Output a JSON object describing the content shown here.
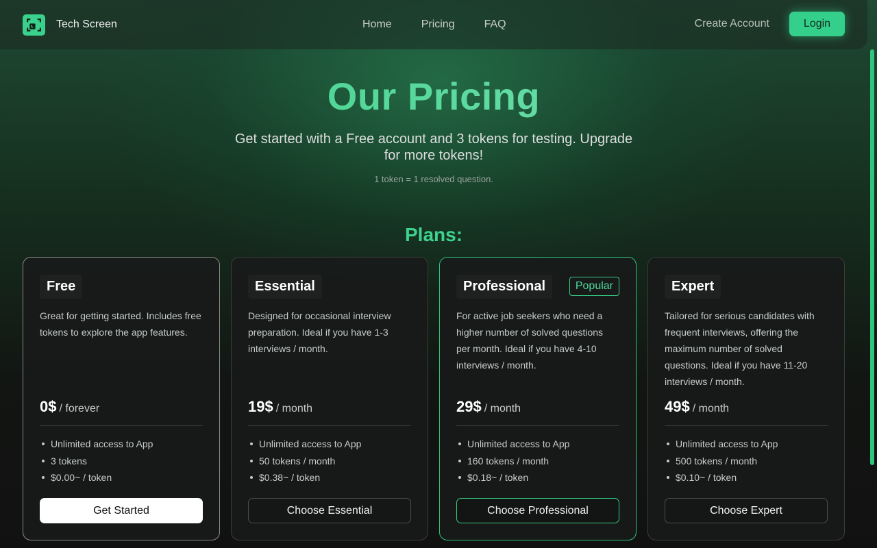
{
  "brand": {
    "name": "Tech Screen",
    "logo_icon": "screen-capture-icon",
    "accent": "#34d08b"
  },
  "nav": {
    "links": [
      {
        "label": "Home"
      },
      {
        "label": "Pricing"
      },
      {
        "label": "FAQ"
      }
    ],
    "create_account": "Create Account",
    "login": "Login"
  },
  "hero": {
    "title": "Our Pricing",
    "subtitle": "Get started with a Free account and 3 tokens for testing. Upgrade for more tokens!",
    "note": "1 token = 1 resolved question."
  },
  "plans_title": "Plans:",
  "plans": [
    {
      "name": "Free",
      "badge": "",
      "description": "Great for getting started. Includes free tokens to explore the app features.",
      "price": "0$",
      "period": "/ forever",
      "features": [
        "Unlimited access to App",
        "3 tokens",
        "$0.00~ / token"
      ],
      "cta": "Get Started"
    },
    {
      "name": "Essential",
      "badge": "",
      "description": "Designed for occasional interview preparation. Ideal if you have 1-3 interviews / month.",
      "price": "19$",
      "period": "/ month",
      "features": [
        "Unlimited access to App",
        "50 tokens / month",
        "$0.38~ / token"
      ],
      "cta": "Choose Essential"
    },
    {
      "name": "Professional",
      "badge": "Popular",
      "description": "For active job seekers who need a higher number of solved questions per month. Ideal if you have 4-10 interviews / month.",
      "price": "29$",
      "period": "/ month",
      "features": [
        "Unlimited access to App",
        "160 tokens / month",
        "$0.18~ / token"
      ],
      "cta": "Choose Professional"
    },
    {
      "name": "Expert",
      "badge": "",
      "description": "Tailored for serious candidates with frequent interviews, offering the maximum number of solved questions. Ideal if you have 11-20 interviews / month.",
      "price": "49$",
      "period": "/ month",
      "features": [
        "Unlimited access to App",
        "500 tokens / month",
        "$0.10~ / token"
      ],
      "cta": "Choose Expert"
    }
  ]
}
